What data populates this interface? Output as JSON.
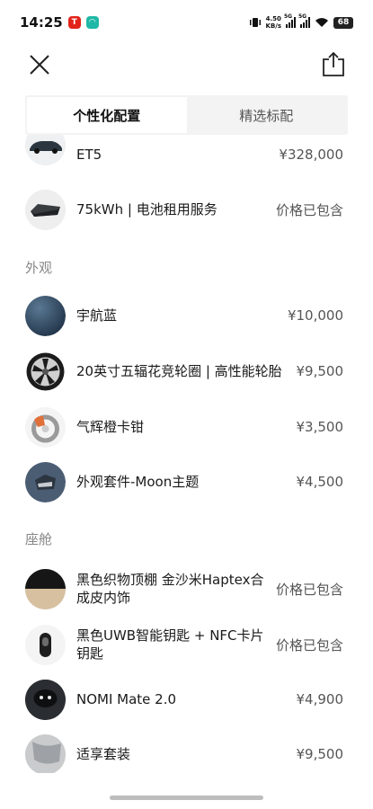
{
  "status_bar": {
    "time": "14:25",
    "net_speed_value": "4.50",
    "net_speed_unit": "KB/s",
    "signal1": "5G",
    "signal2": "5G",
    "battery": "68"
  },
  "tabs": [
    {
      "label": "个性化配置",
      "active": true
    },
    {
      "label": "精选标配",
      "active": false
    }
  ],
  "items_top": [
    {
      "name": "ET5",
      "price": "¥328,000",
      "icon": "car-thumbnail"
    },
    {
      "name": "75kWh | 电池租用服务",
      "price": "价格已包含",
      "icon": "battery-pack-thumbnail"
    }
  ],
  "sections": {
    "exterior": "外观",
    "cabin": "座舱"
  },
  "items_exterior": [
    {
      "name": "宇航蓝",
      "price": "¥10,000",
      "icon": "paint-swatch-blue"
    },
    {
      "name": "20英寸五辐花竞轮圈 | 高性能轮胎",
      "price": "¥9,500",
      "icon": "wheel-rim-thumbnail"
    },
    {
      "name": "气辉橙卡钳",
      "price": "¥3,500",
      "icon": "brake-caliper-thumbnail"
    },
    {
      "name": "外观套件-Moon主题",
      "price": "¥4,500",
      "icon": "exterior-kit-thumbnail"
    }
  ],
  "items_cabin": [
    {
      "name": "黑色织物顶棚 金沙米Haptex合成皮内饰",
      "price": "价格已包含",
      "icon": "interior-swatch-thumbnail"
    },
    {
      "name": "黑色UWB智能钥匙 + NFC卡片钥匙",
      "price": "价格已包含",
      "icon": "smart-key-thumbnail"
    },
    {
      "name": "NOMI Mate 2.0",
      "price": "¥4,900",
      "icon": "nomi-mate-thumbnail"
    },
    {
      "name": "适享套装",
      "price": "¥9,500",
      "icon": "comfort-package-thumbnail"
    }
  ]
}
